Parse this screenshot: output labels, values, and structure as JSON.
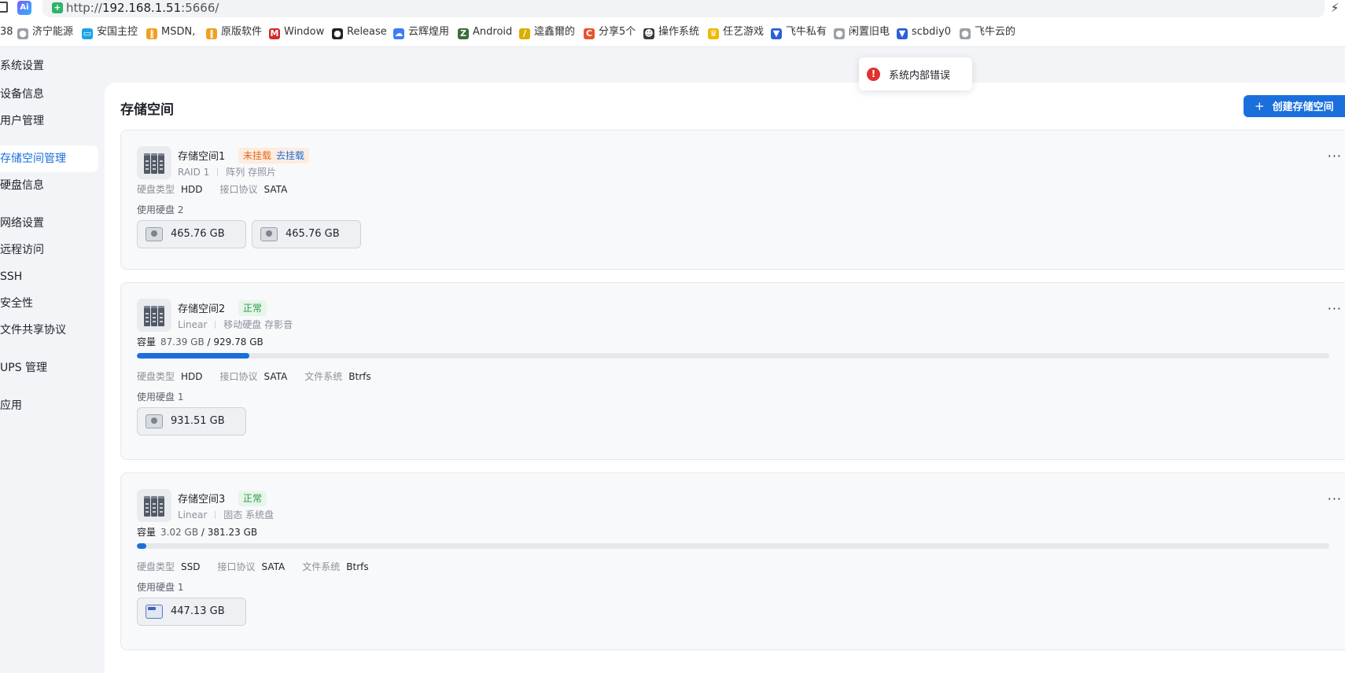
{
  "browser": {
    "url_scheme": "http://",
    "url_host": "192.168.1.51",
    "url_rest": ":5666/",
    "ai_label": "Ai",
    "bookmarks": [
      {
        "label": "38",
        "icon": "number-fragment",
        "color": "#555555"
      },
      {
        "label": "济宁能源",
        "icon": "globe-icon",
        "color": "#9aa0a6"
      },
      {
        "label": "安国主控",
        "icon": "bilibili-icon",
        "color": "#1aa3e8"
      },
      {
        "label": "MSDN,",
        "icon": "msdn-icon",
        "color": "#f0a020"
      },
      {
        "label": "原版软件",
        "icon": "msdn-icon",
        "color": "#f0a020"
      },
      {
        "label": "Window",
        "icon": "m-logo-icon",
        "color": "#d12b2b"
      },
      {
        "label": "Release",
        "icon": "github-icon",
        "color": "#222222"
      },
      {
        "label": "云辉煌用",
        "icon": "cloud-icon",
        "color": "#3d7df5"
      },
      {
        "label": "Android",
        "icon": "z-logo-icon",
        "color": "#3a6d3a"
      },
      {
        "label": "逵鑫爾的",
        "icon": "leaf-icon",
        "color": "#d7b000"
      },
      {
        "label": "分享5个",
        "icon": "c-logo-icon",
        "color": "#e8542c"
      },
      {
        "label": "操作系统",
        "icon": "avatar-icon",
        "color": "#3a3a3a"
      },
      {
        "label": "任艺游戏",
        "icon": "crown-icon",
        "color": "#f0b800"
      },
      {
        "label": "飞牛私有",
        "icon": "feiniu-icon",
        "color": "#2d5fd6"
      },
      {
        "label": "闲置旧电",
        "icon": "globe-icon",
        "color": "#9aa0a6"
      },
      {
        "label": "scbdiy0",
        "icon": "feiniu-icon",
        "color": "#2d5fd6"
      },
      {
        "label": "飞牛云的",
        "icon": "globe-icon",
        "color": "#9aa0a6"
      }
    ]
  },
  "app": {
    "title": "系统设置",
    "sidebar": [
      {
        "label": "设备信息",
        "active": false
      },
      {
        "label": "用户管理",
        "active": false
      },
      {
        "label": "存储空间管理",
        "active": true
      },
      {
        "label": "硬盘信息",
        "active": false
      },
      {
        "label": "网络设置",
        "active": false
      },
      {
        "label": "远程访问",
        "active": false
      },
      {
        "label": "SSH",
        "active": false
      },
      {
        "label": "安全性",
        "active": false
      },
      {
        "label": "文件共享协议",
        "active": false
      },
      {
        "label": "UPS 管理",
        "active": false
      },
      {
        "label": "应用",
        "active": false
      }
    ]
  },
  "main": {
    "title": "存储空间",
    "create_button": "创建存储空间",
    "labels": {
      "disk_type": "硬盘类型",
      "interface": "接口协议",
      "filesystem": "文件系统",
      "capacity": "容量",
      "used_disks": "使用硬盘"
    },
    "pools": [
      {
        "name": "存储空间1",
        "status": "未挂载",
        "status_type": "warn",
        "status_action": "去挂载",
        "raid": "RAID 1",
        "description": "阵列 存照片",
        "disk_type": "HDD",
        "interface": "SATA",
        "filesystem": null,
        "capacity_used": null,
        "capacity_total": null,
        "usage_ratio": null,
        "disk_count": "2",
        "disks": [
          {
            "size": "465.76 GB",
            "kind": "hdd"
          },
          {
            "size": "465.76 GB",
            "kind": "hdd"
          }
        ]
      },
      {
        "name": "存储空间2",
        "status": "正常",
        "status_type": "ok",
        "status_action": null,
        "raid": "Linear",
        "description": "移动硬盘 存影音",
        "disk_type": "HDD",
        "interface": "SATA",
        "filesystem": "Btrfs",
        "capacity_used": "87.39 GB",
        "capacity_total": "929.78 GB",
        "usage_ratio": 0.094,
        "disk_count": "1",
        "disks": [
          {
            "size": "931.51 GB",
            "kind": "hdd"
          }
        ]
      },
      {
        "name": "存储空间3",
        "status": "正常",
        "status_type": "ok",
        "status_action": null,
        "raid": "Linear",
        "description": "固态 系统盘",
        "disk_type": "SSD",
        "interface": "SATA",
        "filesystem": "Btrfs",
        "capacity_used": "3.02 GB",
        "capacity_total": "381.23 GB",
        "usage_ratio": 0.008,
        "disk_count": "1",
        "disks": [
          {
            "size": "447.13 GB",
            "kind": "ssd"
          }
        ]
      }
    ]
  },
  "toast": {
    "message": "系统内部错误",
    "type": "error",
    "color": "#e0322f"
  },
  "colors": {
    "accent": "#1a6fdc",
    "warn": "#e36b1a",
    "ok": "#2f9a48"
  }
}
